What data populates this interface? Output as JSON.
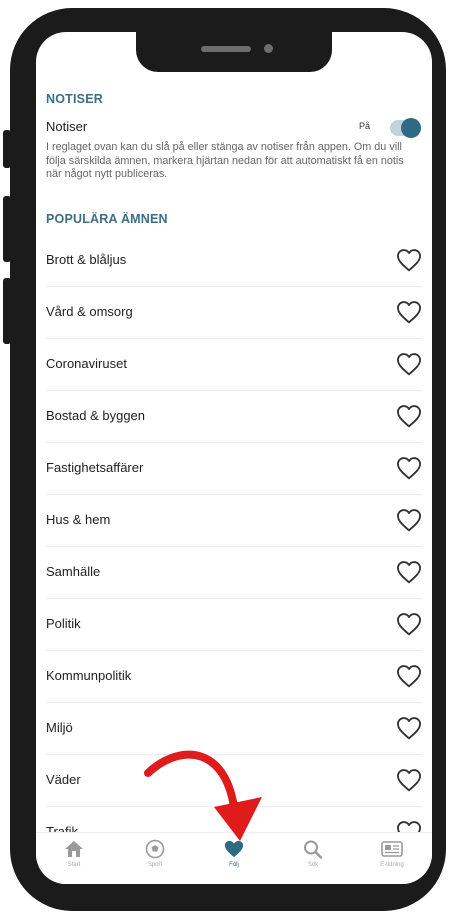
{
  "notiser_section": {
    "title": "NOTISER",
    "toggle_label": "Notiser",
    "toggle_state": "På",
    "help_text": "I reglaget ovan kan du slå på eller stänga av notiser från appen. Om du vill följa särskilda ämnen, markera hjärtan nedan för att automatiskt få en notis när något nytt publiceras."
  },
  "topics_section": {
    "title": "POPULÄRA ÄMNEN",
    "items": [
      {
        "label": "Brott & blåljus"
      },
      {
        "label": "Vård & omsorg"
      },
      {
        "label": "Coronaviruset"
      },
      {
        "label": "Bostad & byggen"
      },
      {
        "label": "Fastighetsaffärer"
      },
      {
        "label": "Hus & hem"
      },
      {
        "label": "Samhälle"
      },
      {
        "label": "Politik"
      },
      {
        "label": "Kommunpolitik"
      },
      {
        "label": "Miljö"
      },
      {
        "label": "Väder"
      },
      {
        "label": "Trafik"
      }
    ]
  },
  "tabbar": {
    "tabs": [
      {
        "label": "Start",
        "icon": "home-icon"
      },
      {
        "label": "Sport",
        "icon": "football-icon"
      },
      {
        "label": "Följ",
        "icon": "heart-icon",
        "active": true
      },
      {
        "label": "Sök",
        "icon": "search-icon"
      },
      {
        "label": "E-tidning",
        "icon": "newspaper-icon"
      }
    ]
  },
  "colors": {
    "accent": "#2f6a84",
    "section_title": "#3c6f86",
    "annotation_arrow": "#e01b1b"
  }
}
